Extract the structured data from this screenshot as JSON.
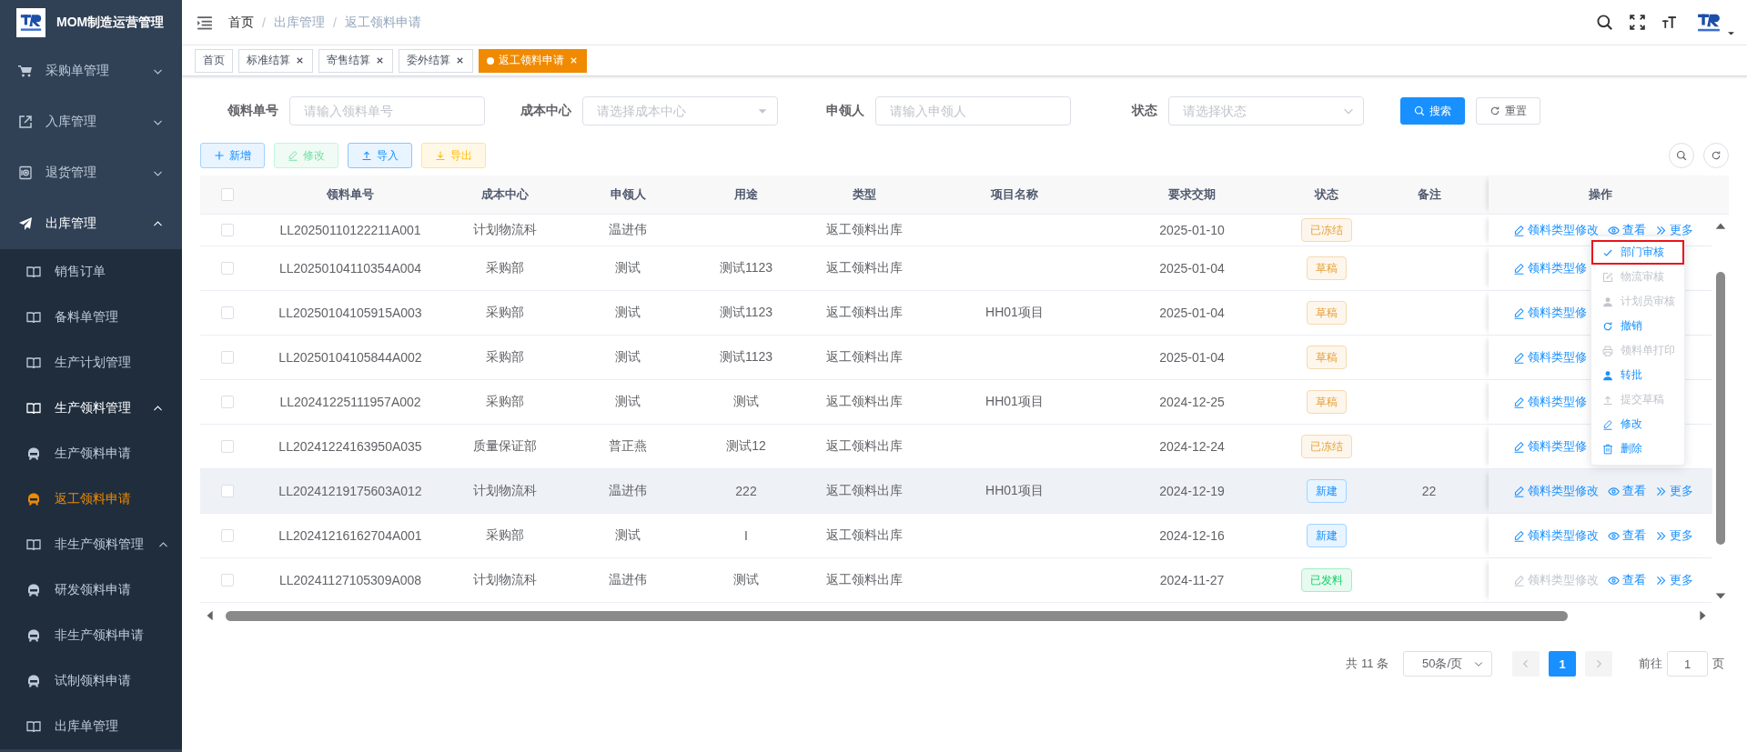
{
  "sidebar": {
    "title": "MOM制造运营管理",
    "items": [
      {
        "label": "采购单管理",
        "expanded": false,
        "selected": false
      },
      {
        "label": "入库管理",
        "expanded": false,
        "selected": false
      },
      {
        "label": "退货管理",
        "expanded": false,
        "selected": false
      },
      {
        "label": "出库管理",
        "expanded": true,
        "selected": false,
        "children": [
          {
            "label": "销售订单",
            "selected": false
          },
          {
            "label": "备料单管理",
            "selected": false
          },
          {
            "label": "生产计划管理",
            "selected": false
          },
          {
            "label": "生产领料管理",
            "expanded": true,
            "selected": false,
            "children": [
              {
                "label": "生产领料申请",
                "selected": false
              },
              {
                "label": "返工领料申请",
                "selected": true
              }
            ]
          },
          {
            "label": "非生产领料管理",
            "expanded": true,
            "selected": false,
            "children": [
              {
                "label": "研发领料申请",
                "selected": false
              },
              {
                "label": "非生产领料申请",
                "selected": false
              },
              {
                "label": "试制领料申请",
                "selected": false
              }
            ]
          },
          {
            "label": "出库单管理",
            "selected": false
          }
        ]
      }
    ]
  },
  "breadcrumb": [
    {
      "label": "首页",
      "link": true
    },
    {
      "separator": "/",
      "label": "出库管理",
      "link": false
    },
    {
      "separator": "/",
      "label": "返工领料申请",
      "link": false
    }
  ],
  "tags": [
    {
      "label": "首页",
      "selected": false,
      "closable": false
    },
    {
      "label": "标准结算",
      "selected": false,
      "closable": true
    },
    {
      "label": "寄售结算",
      "selected": false,
      "closable": true
    },
    {
      "label": "委外结算",
      "selected": false,
      "closable": true
    },
    {
      "label": "返工领料申请",
      "selected": true,
      "closable": true
    }
  ],
  "search_form": {
    "fields": [
      {
        "label": "领料单号",
        "kind": "input",
        "placeholder": "请输入领料单号"
      },
      {
        "label": "成本中心",
        "kind": "caret-select",
        "placeholder": "请选择成本中心"
      },
      {
        "label": "申领人",
        "kind": "input",
        "placeholder": "请输入申领人"
      },
      {
        "label": "状态",
        "kind": "select",
        "placeholder": "请选择状态"
      }
    ],
    "buttons": [
      {
        "label": "搜索",
        "kind": "search"
      },
      {
        "label": "重置",
        "kind": "reset"
      }
    ]
  },
  "toolbar": [
    {
      "label": "新增",
      "kind": "add",
      "disabled": false
    },
    {
      "label": "修改",
      "kind": "edit",
      "disabled": true
    },
    {
      "label": "导入",
      "kind": "import",
      "disabled": false
    },
    {
      "label": "导出",
      "kind": "export",
      "disabled": false
    }
  ],
  "table": {
    "header_checked": false,
    "columns": [
      "领料单号",
      "成本中心",
      "申领人",
      "用途",
      "类型",
      "项目名称",
      "要求交期",
      "状态",
      "备注",
      "操作"
    ],
    "rows": [
      {
        "checked": false,
        "hovered": false,
        "code": "LL20250110122211A001",
        "cost_center": "计划物流科",
        "applicant": "温进伟",
        "type": "返工领料出库",
        "due_date": "2025-01-10",
        "status": {
          "label": "已冻结",
          "kind": "warning"
        },
        "actions": [
          {
            "label": "领料类型修改",
            "kind": "edit",
            "disabled": false
          },
          {
            "label": "查看",
            "kind": "view",
            "disabled": false
          },
          {
            "label": "更多",
            "kind": "more",
            "disabled": false
          }
        ]
      },
      {
        "checked": false,
        "hovered": false,
        "code": "LL20250104110354A004",
        "cost_center": "采购部",
        "applicant": "测试",
        "purpose": "测试1123",
        "type": "返工领料出库",
        "due_date": "2025-01-04",
        "status": {
          "label": "草稿",
          "kind": "warning"
        },
        "actions": [
          {
            "label": "领料类型修",
            "kind": "edit",
            "disabled": false
          }
        ]
      },
      {
        "checked": false,
        "hovered": false,
        "code": "LL20250104105915A003",
        "cost_center": "采购部",
        "applicant": "测试",
        "purpose": "测试1123",
        "type": "返工领料出库",
        "project": "HH01项目",
        "due_date": "2025-01-04",
        "status": {
          "label": "草稿",
          "kind": "warning"
        },
        "actions": [
          {
            "label": "领料类型修",
            "kind": "edit",
            "disabled": false
          }
        ]
      },
      {
        "checked": false,
        "hovered": false,
        "code": "LL20250104105844A002",
        "cost_center": "采购部",
        "applicant": "测试",
        "purpose": "测试1123",
        "type": "返工领料出库",
        "due_date": "2025-01-04",
        "status": {
          "label": "草稿",
          "kind": "warning"
        },
        "actions": [
          {
            "label": "领料类型修",
            "kind": "edit",
            "disabled": false
          }
        ]
      },
      {
        "checked": false,
        "hovered": false,
        "code": "LL20241225111957A002",
        "cost_center": "采购部",
        "applicant": "测试",
        "purpose": "测试",
        "type": "返工领料出库",
        "project": "HH01项目",
        "due_date": "2024-12-25",
        "status": {
          "label": "草稿",
          "kind": "warning"
        },
        "actions": [
          {
            "label": "领料类型修",
            "kind": "edit",
            "disabled": false
          }
        ]
      },
      {
        "checked": false,
        "hovered": false,
        "code": "LL20241224163950A035",
        "cost_center": "质量保证部",
        "applicant": "普正燕",
        "purpose": "测试12",
        "type": "返工领料出库",
        "due_date": "2024-12-24",
        "status": {
          "label": "已冻结",
          "kind": "warning"
        },
        "actions": [
          {
            "label": "领料类型修",
            "kind": "edit",
            "disabled": false
          }
        ]
      },
      {
        "checked": false,
        "hovered": true,
        "code": "LL20241219175603A012",
        "cost_center": "计划物流科",
        "applicant": "温进伟",
        "purpose": "222",
        "type": "返工领料出库",
        "project": "HH01项目",
        "due_date": "2024-12-19",
        "status": {
          "label": "新建",
          "kind": "primary"
        },
        "remark": "22",
        "actions": [
          {
            "label": "领料类型修改",
            "kind": "edit",
            "disabled": false
          },
          {
            "label": "查看",
            "kind": "view",
            "disabled": false
          },
          {
            "label": "更多",
            "kind": "more",
            "disabled": false
          }
        ]
      },
      {
        "checked": false,
        "hovered": false,
        "code": "LL20241216162704A001",
        "cost_center": "采购部",
        "applicant": "测试",
        "purpose": "I",
        "type": "返工领料出库",
        "due_date": "2024-12-16",
        "status": {
          "label": "新建",
          "kind": "primary"
        },
        "actions": [
          {
            "label": "领料类型修改",
            "kind": "edit",
            "disabled": false
          },
          {
            "label": "查看",
            "kind": "view",
            "disabled": false
          },
          {
            "label": "更多",
            "kind": "more",
            "disabled": false
          }
        ]
      },
      {
        "checked": false,
        "hovered": false,
        "code": "LL20241127105309A008",
        "cost_center": "计划物流科",
        "applicant": "温进伟",
        "purpose": "测试",
        "type": "返工领料出库",
        "due_date": "2024-11-27",
        "status": {
          "label": "已发料",
          "kind": "success"
        },
        "actions": [
          {
            "label": "领料类型修改",
            "kind": "edit",
            "disabled": true
          },
          {
            "label": "查看",
            "kind": "view",
            "disabled": false
          },
          {
            "label": "更多",
            "kind": "more",
            "disabled": false
          }
        ]
      }
    ]
  },
  "dropdown_menu": [
    {
      "label": "部门审核",
      "kind": "check",
      "disabled": false,
      "highlighted": true
    },
    {
      "label": "物流审核",
      "kind": "edit-square",
      "disabled": true,
      "highlighted": false
    },
    {
      "label": "计划员审核",
      "kind": "user",
      "disabled": true,
      "highlighted": false
    },
    {
      "label": "撤销",
      "kind": "undo",
      "disabled": false,
      "highlighted": false
    },
    {
      "label": "领料单打印",
      "kind": "print",
      "disabled": true,
      "highlighted": false
    },
    {
      "label": "转批",
      "kind": "user",
      "disabled": false,
      "highlighted": false
    },
    {
      "label": "提交草稿",
      "kind": "upload",
      "disabled": true,
      "highlighted": false
    },
    {
      "label": "修改",
      "kind": "edit",
      "disabled": false,
      "highlighted": false
    },
    {
      "label": "删除",
      "kind": "delete",
      "disabled": false,
      "highlighted": false
    }
  ],
  "pagination": {
    "total": "共 11 条",
    "page_size": "50条/页",
    "pages": [
      {
        "label": "1",
        "selected": true
      }
    ],
    "goto_label": "前往",
    "goto_value": "1",
    "goto_suffix": "页"
  }
}
